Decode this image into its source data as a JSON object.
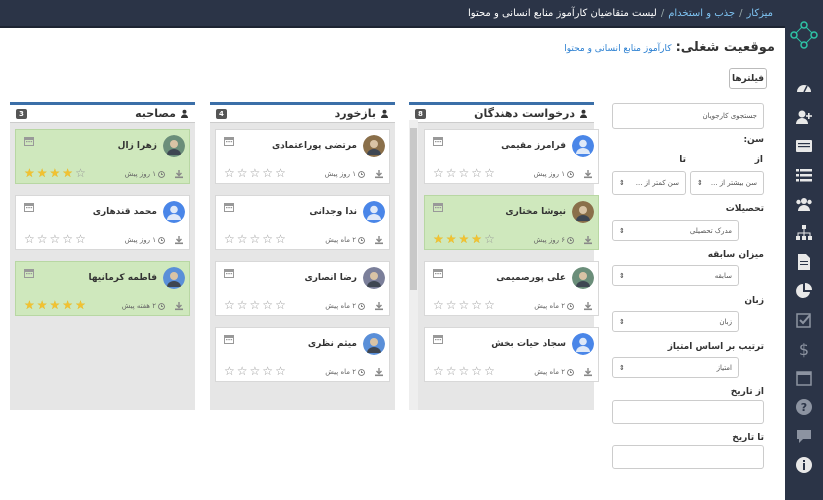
{
  "breadcrumb": {
    "home": "میزکار",
    "sep1": "/",
    "section": "جذب و استخدام",
    "sep2": "/",
    "current": "لیست متقاضیان کارآموز منابع انسانی و محتوا"
  },
  "page": {
    "title_label": "موقعیت شغلی:",
    "title_value": "کارآموز منابع انسانی و محتوا",
    "filter_button": "فیلترها"
  },
  "columns": [
    {
      "title": "درخواست دهندگان",
      "count": "8",
      "cards": [
        {
          "name": "فرامرز مقیمی",
          "time": "۱ روز پیش",
          "stars": 0,
          "green": false
        },
        {
          "name": "نیوشا مختاری",
          "time": "۶ روز پیش",
          "stars": 4,
          "green": true
        },
        {
          "name": "علی پورصمیمی",
          "time": "۲ ماه پیش",
          "stars": 0,
          "green": false
        },
        {
          "name": "سجاد حیات بخش",
          "time": "۲ ماه پیش",
          "stars": 0,
          "green": false
        }
      ]
    },
    {
      "title": "بازخورد",
      "count": "4",
      "cards": [
        {
          "name": "مرتضی پوراعتمادی",
          "time": "۱ روز پیش",
          "stars": 0,
          "green": false
        },
        {
          "name": "ندا وجدانی",
          "time": "۲ ماه پیش",
          "stars": 0,
          "green": false
        },
        {
          "name": "رضا انصاری",
          "time": "۲ ماه پیش",
          "stars": 0,
          "green": false
        },
        {
          "name": "میثم نظری",
          "time": "۲ ماه پیش",
          "stars": 0,
          "green": false
        }
      ]
    },
    {
      "title": "مصاحبه",
      "count": "3",
      "cards": [
        {
          "name": "زهرا زال",
          "time": "۱ روز پیش",
          "stars": 4,
          "green": true
        },
        {
          "name": "محمد قندهاری",
          "time": "۱ روز پیش",
          "stars": 0,
          "green": false
        },
        {
          "name": "فاطمه کرمانیها",
          "time": "۲ هفته پیش",
          "stars": 5,
          "green": true
        }
      ]
    }
  ],
  "filters": {
    "search_placeholder": "جستجوی کارجویان",
    "age_label": "سن:",
    "from_label": "از",
    "to_label": "تا",
    "age_from_placeholder": "سن بیشتر از ...",
    "age_to_placeholder": "سن کمتر از ...",
    "education_label": "تحصیلات",
    "education_value": "مدرک تحصیلی",
    "experience_label": "میزان سابقه",
    "experience_value": "سابقه",
    "language_label": "زبان",
    "language_value": "زبان",
    "sort_label": "ترتیب بر اساس امتیاز",
    "sort_value": "امتیاز",
    "date_from_label": "از تاریخ",
    "date_to_label": "تا تاریخ"
  },
  "colors": {
    "topbar": "#2b3447",
    "accent": "#3b6fa8",
    "green_card": "#cfe8bd",
    "star": "#f1c232"
  }
}
